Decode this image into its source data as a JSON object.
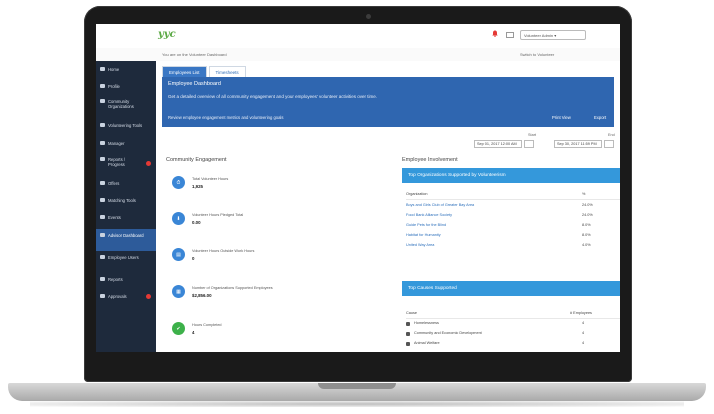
{
  "topbar": {
    "logo_text": "yyc",
    "user_label": "Volunteer Admin ▾"
  },
  "subbar": {
    "welcome": "You are on the Volunteer Dashboard",
    "switch_link": "Switch to Volunteer"
  },
  "sidebar": {
    "items": [
      {
        "label": "Home"
      },
      {
        "label": "Profile"
      },
      {
        "label": "Community Organizations"
      },
      {
        "label": "Volunteering Tools"
      },
      {
        "label": "Manager"
      },
      {
        "label": "Reports / Progress"
      },
      {
        "label": "Offers"
      },
      {
        "label": "Matching Tools"
      },
      {
        "label": "Events"
      },
      {
        "label": "Advisor Dashboard"
      },
      {
        "label": "Employee Users"
      },
      {
        "label": "Reports"
      },
      {
        "label": "Approvals"
      }
    ]
  },
  "tabs": [
    {
      "label": "Employees List"
    },
    {
      "label": "Timesheets"
    }
  ],
  "banner": {
    "title": "Employee Dashboard",
    "description": "Get a detailed overview of all community engagement and your employees' volunteer activities over time.",
    "link": "Review employee engagement metrics and volunteering goals",
    "btn_print": "Print View",
    "btn_export": "Export"
  },
  "dates": {
    "start_label": "Start",
    "end_label": "End",
    "start_value": "Sep 01, 2017 12:00 AM",
    "end_value": "Sep 30, 2017 11:59 PM"
  },
  "community": {
    "title": "Community Engagement",
    "metrics": [
      {
        "label": "Total Volunteer Hours",
        "value": "1,925"
      },
      {
        "label": "Volunteer Hours Pledged Total",
        "value": "0.00"
      },
      {
        "label": "Volunteer Hours Outside Work Hours",
        "value": "0"
      },
      {
        "label": "Number of Organizations Supported Employees",
        "value": "$2,856.00"
      },
      {
        "label": "Hours Completed",
        "value": "4"
      }
    ]
  },
  "employees": {
    "title": "Employee Involvement",
    "top_orgs": {
      "title": "Top Organizations Supported by Volunteerism",
      "col_org": "Organization",
      "col_pct": "%",
      "rows": [
        {
          "name": "Boys and Girls Club of Greater Bay Area",
          "pct": "24.0%"
        },
        {
          "name": "Food Bank Alliance Society",
          "pct": "24.0%"
        },
        {
          "name": "Guide Pets for the Blind",
          "pct": "8.0%"
        },
        {
          "name": "Habitat for Humanity",
          "pct": "8.0%"
        },
        {
          "name": "United Way Area",
          "pct": "4.0%"
        }
      ]
    },
    "top_causes": {
      "title": "Top Causes Supported",
      "col_cause": "Cause",
      "col_emp": "# Employees",
      "rows": [
        {
          "name": "Homelessness",
          "count": "4"
        },
        {
          "name": "Community and Economic Development",
          "count": "4"
        },
        {
          "name": "Animal Welfare",
          "count": "4"
        }
      ]
    }
  },
  "colors": {
    "sidebar": "#1e2a3c",
    "sidebar_active": "#2d5b9a",
    "banner": "#2f66b0",
    "panel_head": "#3498db",
    "accent_green": "#3db14a",
    "alert_red": "#e53935"
  }
}
